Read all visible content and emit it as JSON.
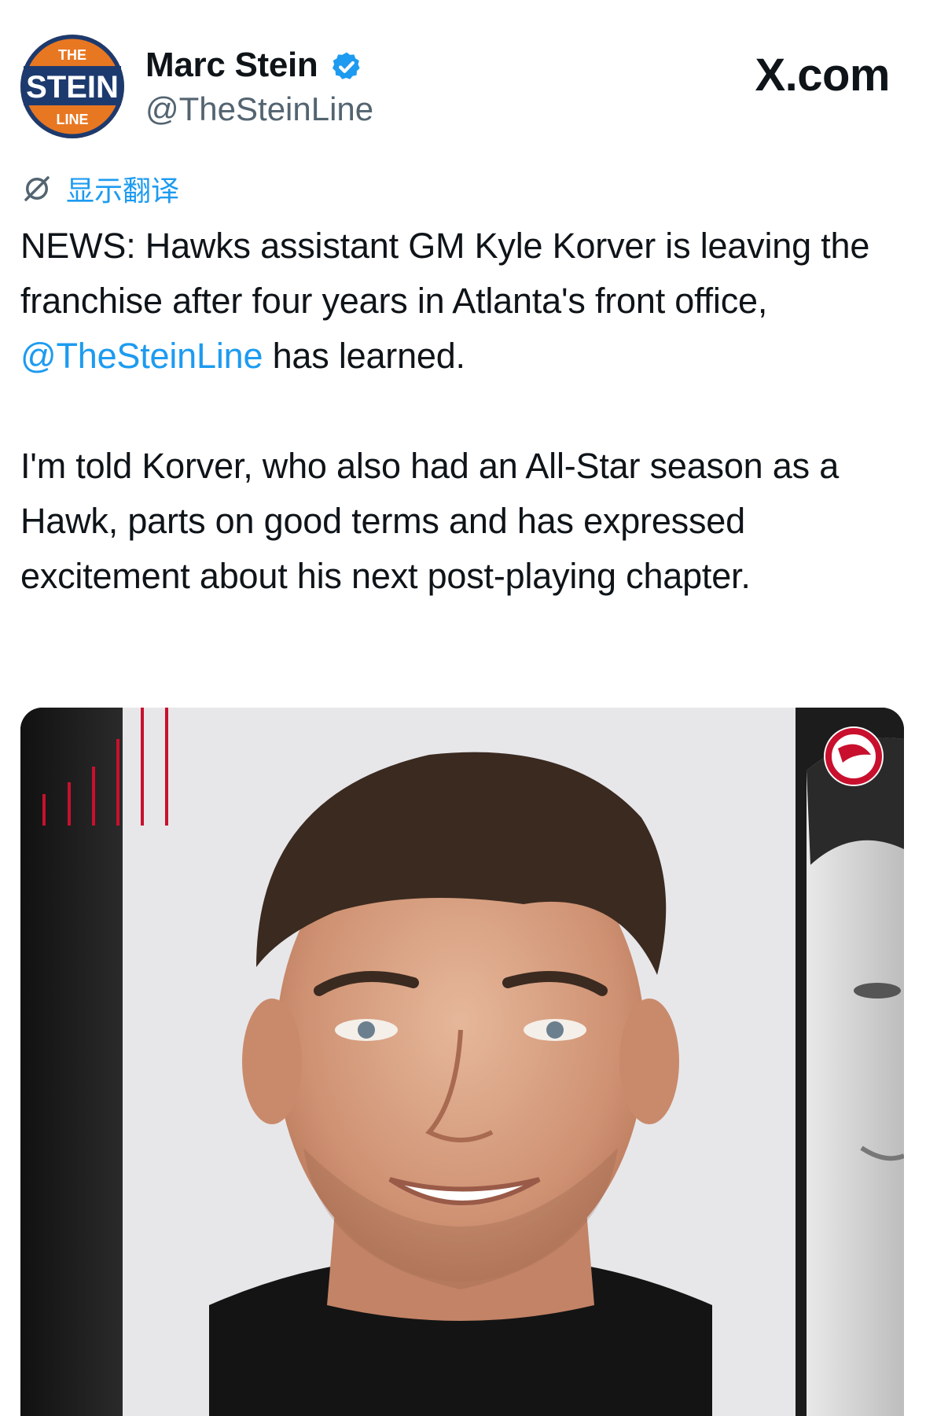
{
  "author": {
    "name": "Marc Stein",
    "handle": "@TheSteinLine",
    "avatar_logo": {
      "top": "THE",
      "middle": "STEIN",
      "bottom": "LINE"
    },
    "verified_icon": "verified-badge-icon"
  },
  "source_label": "X.com",
  "translate": {
    "icon": "translate-icon",
    "label": "显示翻译"
  },
  "tweet": {
    "para1_before": "NEWS: Hawks assistant GM Kyle Korver is leaving the franchise after four years in Atlanta's front office, ",
    "para1_mention": "@TheSteinLine",
    "para1_after": " has learned.",
    "para2": "I'm told Korver, who also had an All-Star season as a Hawk, parts on good terms and has expressed excitement about his next post-playing chapter."
  },
  "media": {
    "description_icon": "hawks-logo-icon"
  },
  "colors": {
    "link": "#1d9bf0",
    "text": "#0f1419",
    "secondary": "#536471",
    "hawks_red": "#c8102e"
  }
}
